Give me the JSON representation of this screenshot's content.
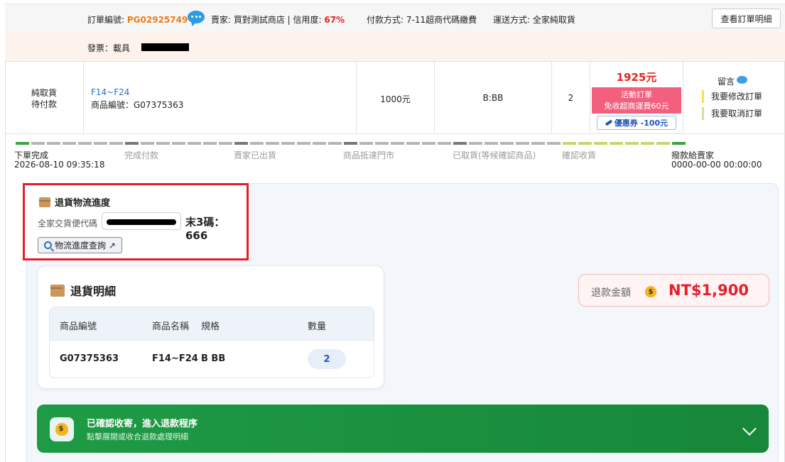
{
  "header": {
    "order_label": "訂單編號: ",
    "order_no": "PG02925749",
    "seller_prefix": "賣家: 買對測試商店 | 信用度: ",
    "credit": "67%",
    "payment": "付款方式: 7-11超商代碼繳費",
    "shipping": "運送方式: 全家純取貨",
    "view_button": "查看訂單明細",
    "invoice": "發票：載具"
  },
  "product_row": {
    "status_line1": "純取貨",
    "status_line2": "待付款",
    "product_name": "F14~F24",
    "product_code": "商品編號：G07375363",
    "price": "1000元",
    "spec": "B:BB",
    "qty": "2",
    "total": "1925元",
    "promo_line1": "活動訂單",
    "promo_line2": "免收超商運費60元",
    "coupon": "優惠券 -100元",
    "message_label": "留言",
    "action_modify": "我要修改訂單",
    "action_cancel": "我要取消訂單"
  },
  "progress": {
    "steps": [
      "下單完成",
      "完成付款",
      "賣家已出貨",
      "商品抵達門市",
      "已取貨(等候確認商品)",
      "確認收貨",
      "撥款給賣家"
    ],
    "start_time": "2026-08-10 09:35:18",
    "end_time": "0000-00-00 00:00:00",
    "colors": {
      "done": "#3aa640",
      "pending": "#b5b5b5",
      "divider": "#777777",
      "final": "#c3d96b"
    }
  },
  "return_tracking": {
    "title": "退貨物流進度",
    "code_label": "全家交貨便代碼",
    "last3": "末3碼：666",
    "track_button": "物流進度查詢 ↗"
  },
  "return_detail": {
    "title": "退貨明細",
    "headers": [
      "商品編號",
      "商品名稱",
      "規格",
      "數量"
    ],
    "row": {
      "code": "G07375363",
      "name": "F14~F24",
      "spec": "B BB",
      "qty": "2"
    }
  },
  "refund": {
    "label": "退款金額",
    "amount": "NT$1,900"
  },
  "refund_status": {
    "title": "已確認收寄，進入退款程序",
    "subtitle": "點擊展開或收合退款處理明細"
  }
}
